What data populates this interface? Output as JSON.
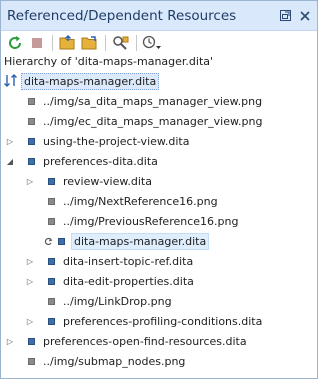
{
  "view": {
    "title": "Referenced/Dependent Resources",
    "hierarchy_label": "Hierarchy of 'dita-maps-manager.dita'"
  },
  "toolbar": {
    "icons": [
      "refresh-icon",
      "stop-icon",
      "open-folder-icon",
      "open-folder-alt-icon",
      "find-references-icon",
      "history-dropdown-icon"
    ]
  },
  "tree": {
    "rows": [
      {
        "label": "dita-maps-manager.dita",
        "icon": "sort-icon",
        "twisty": "",
        "selected": false,
        "root": true
      },
      {
        "label": "../img/sa_dita_maps_manager_view.png",
        "icon": "gray",
        "twisty": ""
      },
      {
        "label": "../img/ec_dita_maps_manager_view.png",
        "icon": "gray",
        "twisty": ""
      },
      {
        "label": "using-the-project-view.dita",
        "icon": "blue",
        "twisty": "▷"
      },
      {
        "label": "preferences-dita.dita",
        "icon": "blue",
        "twisty": "◢"
      },
      {
        "label": "review-view.dita",
        "icon": "blue",
        "twisty": "▷"
      },
      {
        "label": "../img/NextReference16.png",
        "icon": "gray",
        "twisty": ""
      },
      {
        "label": "../img/PreviousReference16.png",
        "icon": "gray",
        "twisty": ""
      },
      {
        "label": "dita-maps-manager.dita",
        "icon": "blue",
        "twisty": "",
        "selected": true,
        "cycle": true
      },
      {
        "label": "dita-insert-topic-ref.dita",
        "icon": "blue",
        "twisty": "▷"
      },
      {
        "label": "dita-edit-properties.dita",
        "icon": "blue",
        "twisty": "▷"
      },
      {
        "label": "../img/LinkDrop.png",
        "icon": "gray",
        "twisty": ""
      },
      {
        "label": "preferences-profiling-conditions.dita",
        "icon": "blue",
        "twisty": "▷"
      },
      {
        "label": "preferences-open-find-resources.dita",
        "icon": "blue",
        "twisty": "▷"
      },
      {
        "label": "../img/submap_nodes.png",
        "icon": "gray",
        "twisty": ""
      }
    ]
  }
}
